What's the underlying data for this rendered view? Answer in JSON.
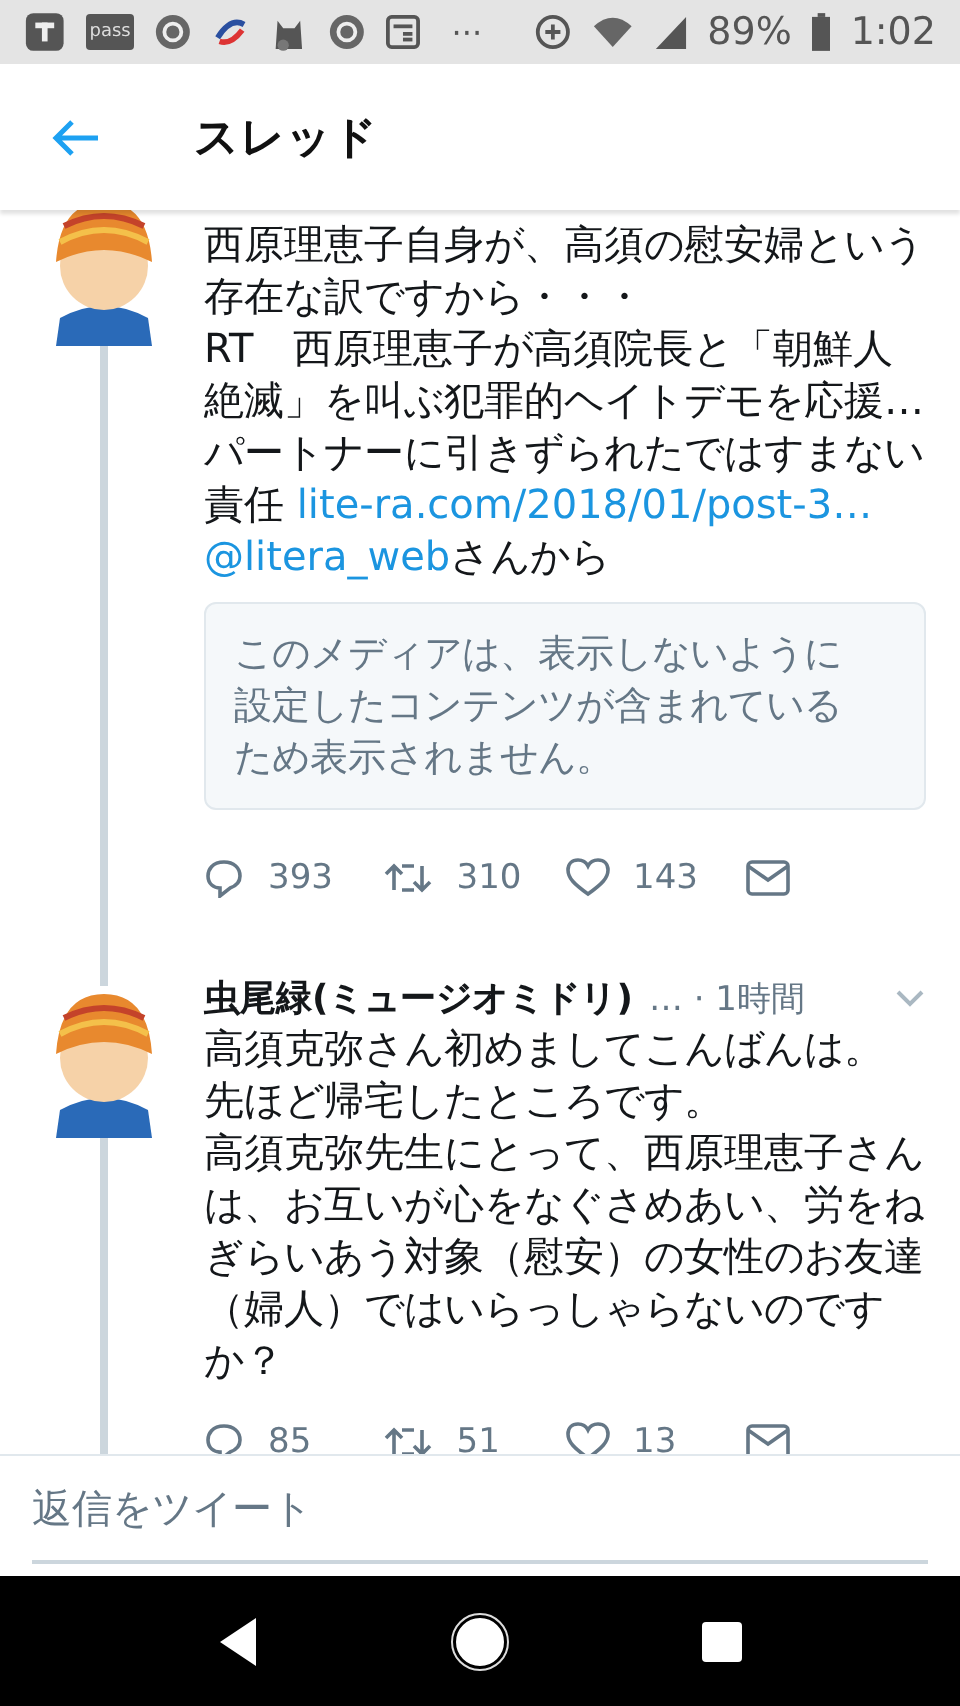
{
  "status_bar": {
    "pass_label": "pass",
    "overflow": "···",
    "battery": "89%",
    "time": "1:02"
  },
  "header": {
    "title": "スレッド"
  },
  "tweets": [
    {
      "body": [
        [
          {
            "kind": "text",
            "text": "西原理恵子自身が、高須の慰安婦という存在な訳ですから・・・"
          }
        ],
        [
          {
            "kind": "text",
            "text": "RT　西原理恵子が高須院長と「朝鮮人絶滅」を叫ぶ犯罪的ヘイトデモを応援…パートナーに引きずられたではすまない責任 "
          },
          {
            "kind": "link",
            "text": "lite-ra.com/2018/01/post-3…"
          }
        ],
        [
          {
            "kind": "link",
            "text": "@litera_web"
          },
          {
            "kind": "text",
            "text": "さんから"
          }
        ]
      ],
      "media_notice": "このメディアは、表示しないように設定したコンテンツが含まれているため表示されません。",
      "actions": [
        {
          "kind": "reply",
          "count": "393"
        },
        {
          "kind": "retweet",
          "count": "310"
        },
        {
          "kind": "like",
          "count": "143"
        },
        {
          "kind": "message"
        }
      ]
    },
    {
      "author": {
        "name": "虫尾緑(ミュージオミドリ)",
        "meta": "… · 1時間"
      },
      "body": [
        [
          {
            "kind": "text",
            "text": "高須克弥さん初めましてこんばんは。"
          }
        ],
        [
          {
            "kind": "text",
            "text": "先ほど帰宅したところです。"
          }
        ],
        [
          {
            "kind": "text",
            "text": "高須克弥先生にとって、西原理恵子さんは、お互いが心をなぐさめあい、労をねぎらいあう対象（慰安）の女性のお友達（婦人）ではいらっしゃらないのですか？"
          }
        ]
      ],
      "actions": [
        {
          "kind": "reply",
          "count": "85"
        },
        {
          "kind": "retweet",
          "count": "51"
        },
        {
          "kind": "like",
          "count": "13"
        },
        {
          "kind": "message"
        }
      ]
    }
  ],
  "reply_field": {
    "placeholder": "返信をツイート"
  }
}
